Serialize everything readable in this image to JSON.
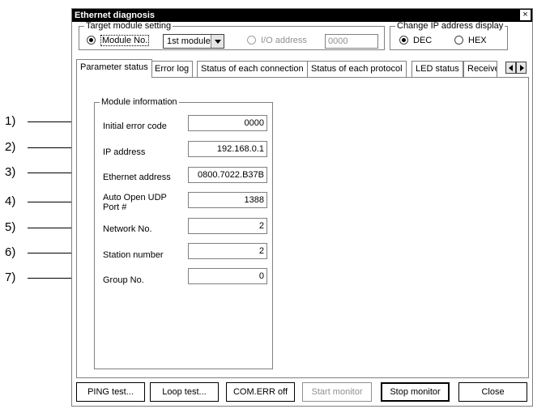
{
  "window": {
    "title": "Ethernet diagnosis",
    "close_glyph": "×"
  },
  "target_module": {
    "legend": "Target module setting",
    "module_no_label": "Module No.",
    "module_select_value": "1st module",
    "io_address_label": "I/O address",
    "io_address_value": "0000"
  },
  "ip_display": {
    "legend": "Change IP address display",
    "dec_label": "DEC",
    "hex_label": "HEX"
  },
  "tabs": [
    "Parameter status",
    "Error log",
    "Status of each connection",
    "Status of each protocol",
    "LED status",
    "Receive"
  ],
  "module_info": {
    "legend": "Module information",
    "fields": [
      {
        "callout": "1)",
        "label": "Initial error code",
        "value": "0000"
      },
      {
        "callout": "2)",
        "label": "IP address",
        "value": "192.168.0.1"
      },
      {
        "callout": "3)",
        "label": "Ethernet address",
        "value": "0800.7022.B37B"
      },
      {
        "callout": "4)",
        "label": "Auto Open UDP Port #",
        "value": "1388"
      },
      {
        "callout": "5)",
        "label": "Network No.",
        "value": "2"
      },
      {
        "callout": "6)",
        "label": "Station number",
        "value": "2"
      },
      {
        "callout": "7)",
        "label": "Group No.",
        "value": "0"
      }
    ]
  },
  "buttons": {
    "ping": "PING test...",
    "loop": "Loop test...",
    "comerr": "COM.ERR off",
    "start": "Start monitor",
    "stop": "Stop monitor",
    "close": "Close"
  }
}
